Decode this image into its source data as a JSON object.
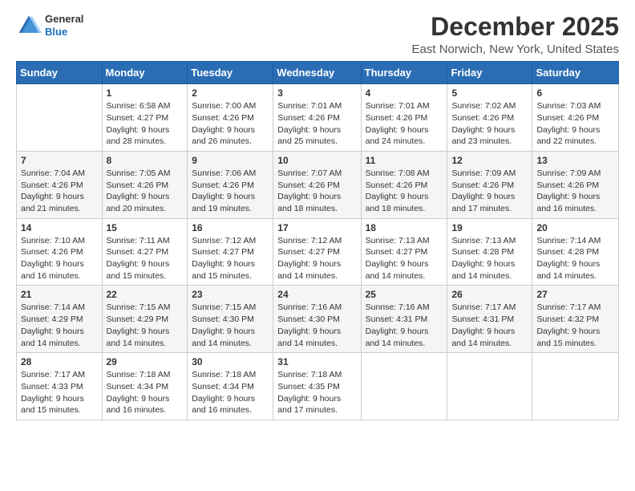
{
  "logo": {
    "line1": "General",
    "line2": "Blue"
  },
  "title": "December 2025",
  "subtitle": "East Norwich, New York, United States",
  "days_of_week": [
    "Sunday",
    "Monday",
    "Tuesday",
    "Wednesday",
    "Thursday",
    "Friday",
    "Saturday"
  ],
  "weeks": [
    [
      {
        "num": "",
        "sunrise": "",
        "sunset": "",
        "daylight": ""
      },
      {
        "num": "1",
        "sunrise": "Sunrise: 6:58 AM",
        "sunset": "Sunset: 4:27 PM",
        "daylight": "Daylight: 9 hours and 28 minutes."
      },
      {
        "num": "2",
        "sunrise": "Sunrise: 7:00 AM",
        "sunset": "Sunset: 4:26 PM",
        "daylight": "Daylight: 9 hours and 26 minutes."
      },
      {
        "num": "3",
        "sunrise": "Sunrise: 7:01 AM",
        "sunset": "Sunset: 4:26 PM",
        "daylight": "Daylight: 9 hours and 25 minutes."
      },
      {
        "num": "4",
        "sunrise": "Sunrise: 7:01 AM",
        "sunset": "Sunset: 4:26 PM",
        "daylight": "Daylight: 9 hours and 24 minutes."
      },
      {
        "num": "5",
        "sunrise": "Sunrise: 7:02 AM",
        "sunset": "Sunset: 4:26 PM",
        "daylight": "Daylight: 9 hours and 23 minutes."
      },
      {
        "num": "6",
        "sunrise": "Sunrise: 7:03 AM",
        "sunset": "Sunset: 4:26 PM",
        "daylight": "Daylight: 9 hours and 22 minutes."
      }
    ],
    [
      {
        "num": "7",
        "sunrise": "Sunrise: 7:04 AM",
        "sunset": "Sunset: 4:26 PM",
        "daylight": "Daylight: 9 hours and 21 minutes."
      },
      {
        "num": "8",
        "sunrise": "Sunrise: 7:05 AM",
        "sunset": "Sunset: 4:26 PM",
        "daylight": "Daylight: 9 hours and 20 minutes."
      },
      {
        "num": "9",
        "sunrise": "Sunrise: 7:06 AM",
        "sunset": "Sunset: 4:26 PM",
        "daylight": "Daylight: 9 hours and 19 minutes."
      },
      {
        "num": "10",
        "sunrise": "Sunrise: 7:07 AM",
        "sunset": "Sunset: 4:26 PM",
        "daylight": "Daylight: 9 hours and 18 minutes."
      },
      {
        "num": "11",
        "sunrise": "Sunrise: 7:08 AM",
        "sunset": "Sunset: 4:26 PM",
        "daylight": "Daylight: 9 hours and 18 minutes."
      },
      {
        "num": "12",
        "sunrise": "Sunrise: 7:09 AM",
        "sunset": "Sunset: 4:26 PM",
        "daylight": "Daylight: 9 hours and 17 minutes."
      },
      {
        "num": "13",
        "sunrise": "Sunrise: 7:09 AM",
        "sunset": "Sunset: 4:26 PM",
        "daylight": "Daylight: 9 hours and 16 minutes."
      }
    ],
    [
      {
        "num": "14",
        "sunrise": "Sunrise: 7:10 AM",
        "sunset": "Sunset: 4:26 PM",
        "daylight": "Daylight: 9 hours and 16 minutes."
      },
      {
        "num": "15",
        "sunrise": "Sunrise: 7:11 AM",
        "sunset": "Sunset: 4:27 PM",
        "daylight": "Daylight: 9 hours and 15 minutes."
      },
      {
        "num": "16",
        "sunrise": "Sunrise: 7:12 AM",
        "sunset": "Sunset: 4:27 PM",
        "daylight": "Daylight: 9 hours and 15 minutes."
      },
      {
        "num": "17",
        "sunrise": "Sunrise: 7:12 AM",
        "sunset": "Sunset: 4:27 PM",
        "daylight": "Daylight: 9 hours and 14 minutes."
      },
      {
        "num": "18",
        "sunrise": "Sunrise: 7:13 AM",
        "sunset": "Sunset: 4:27 PM",
        "daylight": "Daylight: 9 hours and 14 minutes."
      },
      {
        "num": "19",
        "sunrise": "Sunrise: 7:13 AM",
        "sunset": "Sunset: 4:28 PM",
        "daylight": "Daylight: 9 hours and 14 minutes."
      },
      {
        "num": "20",
        "sunrise": "Sunrise: 7:14 AM",
        "sunset": "Sunset: 4:28 PM",
        "daylight": "Daylight: 9 hours and 14 minutes."
      }
    ],
    [
      {
        "num": "21",
        "sunrise": "Sunrise: 7:14 AM",
        "sunset": "Sunset: 4:29 PM",
        "daylight": "Daylight: 9 hours and 14 minutes."
      },
      {
        "num": "22",
        "sunrise": "Sunrise: 7:15 AM",
        "sunset": "Sunset: 4:29 PM",
        "daylight": "Daylight: 9 hours and 14 minutes."
      },
      {
        "num": "23",
        "sunrise": "Sunrise: 7:15 AM",
        "sunset": "Sunset: 4:30 PM",
        "daylight": "Daylight: 9 hours and 14 minutes."
      },
      {
        "num": "24",
        "sunrise": "Sunrise: 7:16 AM",
        "sunset": "Sunset: 4:30 PM",
        "daylight": "Daylight: 9 hours and 14 minutes."
      },
      {
        "num": "25",
        "sunrise": "Sunrise: 7:16 AM",
        "sunset": "Sunset: 4:31 PM",
        "daylight": "Daylight: 9 hours and 14 minutes."
      },
      {
        "num": "26",
        "sunrise": "Sunrise: 7:17 AM",
        "sunset": "Sunset: 4:31 PM",
        "daylight": "Daylight: 9 hours and 14 minutes."
      },
      {
        "num": "27",
        "sunrise": "Sunrise: 7:17 AM",
        "sunset": "Sunset: 4:32 PM",
        "daylight": "Daylight: 9 hours and 15 minutes."
      }
    ],
    [
      {
        "num": "28",
        "sunrise": "Sunrise: 7:17 AM",
        "sunset": "Sunset: 4:33 PM",
        "daylight": "Daylight: 9 hours and 15 minutes."
      },
      {
        "num": "29",
        "sunrise": "Sunrise: 7:18 AM",
        "sunset": "Sunset: 4:34 PM",
        "daylight": "Daylight: 9 hours and 16 minutes."
      },
      {
        "num": "30",
        "sunrise": "Sunrise: 7:18 AM",
        "sunset": "Sunset: 4:34 PM",
        "daylight": "Daylight: 9 hours and 16 minutes."
      },
      {
        "num": "31",
        "sunrise": "Sunrise: 7:18 AM",
        "sunset": "Sunset: 4:35 PM",
        "daylight": "Daylight: 9 hours and 17 minutes."
      },
      {
        "num": "",
        "sunrise": "",
        "sunset": "",
        "daylight": ""
      },
      {
        "num": "",
        "sunrise": "",
        "sunset": "",
        "daylight": ""
      },
      {
        "num": "",
        "sunrise": "",
        "sunset": "",
        "daylight": ""
      }
    ]
  ]
}
